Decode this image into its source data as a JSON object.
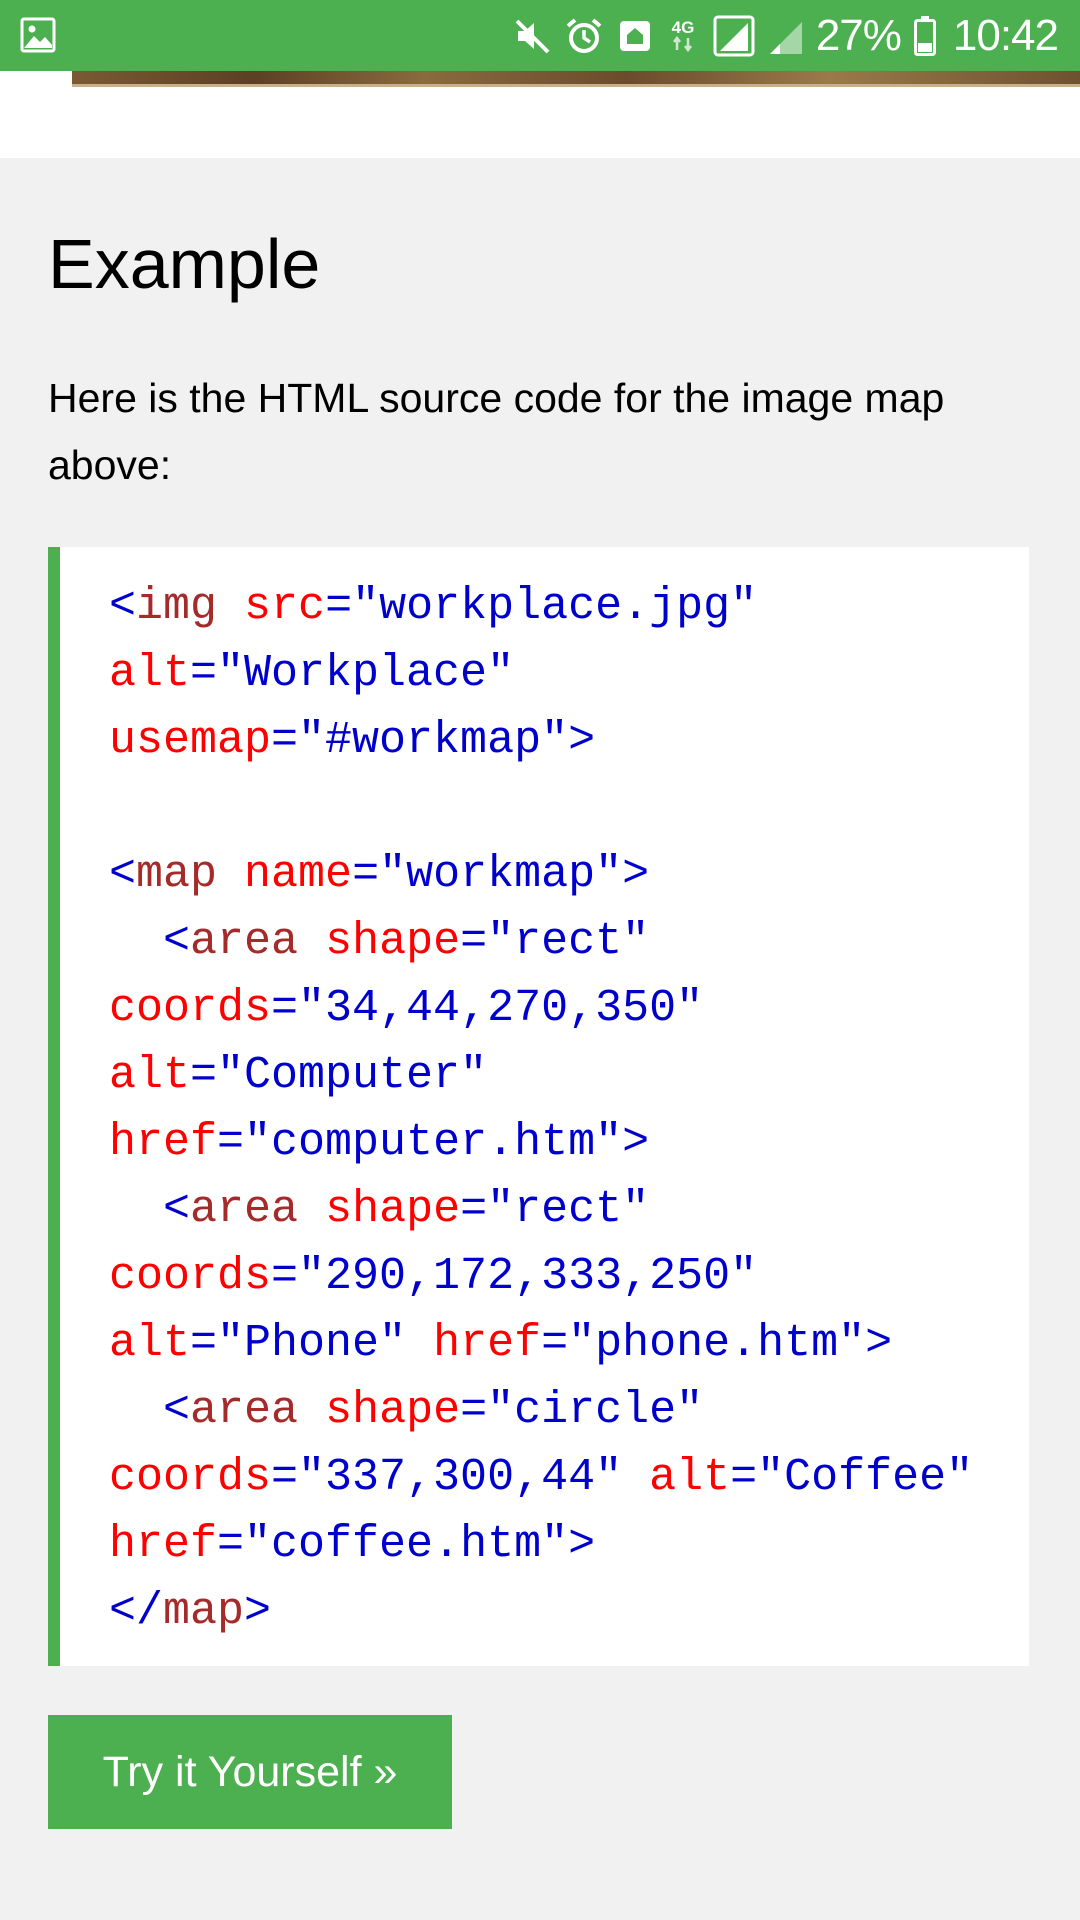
{
  "status_bar": {
    "battery_percent": "27%",
    "time": "10:42",
    "network": "4G",
    "icons": [
      "gallery-icon",
      "mute-icon",
      "alarm-icon",
      "home-icon",
      "network-4g-icon",
      "signal-icon",
      "signal-icon",
      "battery-icon"
    ]
  },
  "example": {
    "heading": "Example",
    "intro": "Here is the HTML source code for the image map above:",
    "code": [
      [
        [
          "brack",
          "<"
        ],
        [
          "tag",
          "img"
        ],
        [
          "plain",
          " "
        ],
        [
          "attr",
          "src"
        ],
        [
          "val",
          "=\"workplace.jpg\""
        ]
      ],
      [
        [
          "attr",
          "alt"
        ],
        [
          "val",
          "=\"Workplace\""
        ]
      ],
      [
        [
          "attr",
          "usemap"
        ],
        [
          "val",
          "=\"#workmap\""
        ],
        [
          "brack",
          ">"
        ]
      ],
      [],
      [
        [
          "brack",
          "<"
        ],
        [
          "tag",
          "map"
        ],
        [
          "plain",
          " "
        ],
        [
          "attr",
          "name"
        ],
        [
          "val",
          "=\"workmap\""
        ],
        [
          "brack",
          ">"
        ]
      ],
      [
        [
          "plain",
          "  "
        ],
        [
          "brack",
          "<"
        ],
        [
          "tag",
          "area"
        ],
        [
          "plain",
          " "
        ],
        [
          "attr",
          "shape"
        ],
        [
          "val",
          "=\"rect\""
        ]
      ],
      [
        [
          "attr",
          "coords"
        ],
        [
          "val",
          "=\"34,44,270,350\""
        ]
      ],
      [
        [
          "attr",
          "alt"
        ],
        [
          "val",
          "=\"Computer\""
        ]
      ],
      [
        [
          "attr",
          "href"
        ],
        [
          "val",
          "=\"computer.htm\""
        ],
        [
          "brack",
          ">"
        ]
      ],
      [
        [
          "plain",
          "  "
        ],
        [
          "brack",
          "<"
        ],
        [
          "tag",
          "area"
        ],
        [
          "plain",
          " "
        ],
        [
          "attr",
          "shape"
        ],
        [
          "val",
          "=\"rect\""
        ]
      ],
      [
        [
          "attr",
          "coords"
        ],
        [
          "val",
          "=\"290,172,333,250\""
        ]
      ],
      [
        [
          "attr",
          "alt"
        ],
        [
          "val",
          "=\"Phone\""
        ],
        [
          "plain",
          " "
        ],
        [
          "attr",
          "href"
        ],
        [
          "val",
          "=\"phone.htm\""
        ],
        [
          "brack",
          ">"
        ]
      ],
      [
        [
          "plain",
          "  "
        ],
        [
          "brack",
          "<"
        ],
        [
          "tag",
          "area"
        ],
        [
          "plain",
          " "
        ],
        [
          "attr",
          "shape"
        ],
        [
          "val",
          "=\"circle\""
        ]
      ],
      [
        [
          "attr",
          "coords"
        ],
        [
          "val",
          "=\"337,300,44\""
        ],
        [
          "plain",
          " "
        ],
        [
          "attr",
          "alt"
        ],
        [
          "val",
          "=\"Coffee\""
        ]
      ],
      [
        [
          "attr",
          "href"
        ],
        [
          "val",
          "=\"coffee.htm\""
        ],
        [
          "brack",
          ">"
        ]
      ],
      [
        [
          "brack",
          "</"
        ],
        [
          "tag",
          "map"
        ],
        [
          "brack",
          ">"
        ]
      ]
    ],
    "try_button_label": "Try it Yourself »"
  },
  "colors": {
    "accent": "#4caf50",
    "code_tag": "#a52a2a",
    "code_attribute": "#ff0000",
    "code_value": "#0000cd",
    "page_background": "#f1f1f1"
  }
}
